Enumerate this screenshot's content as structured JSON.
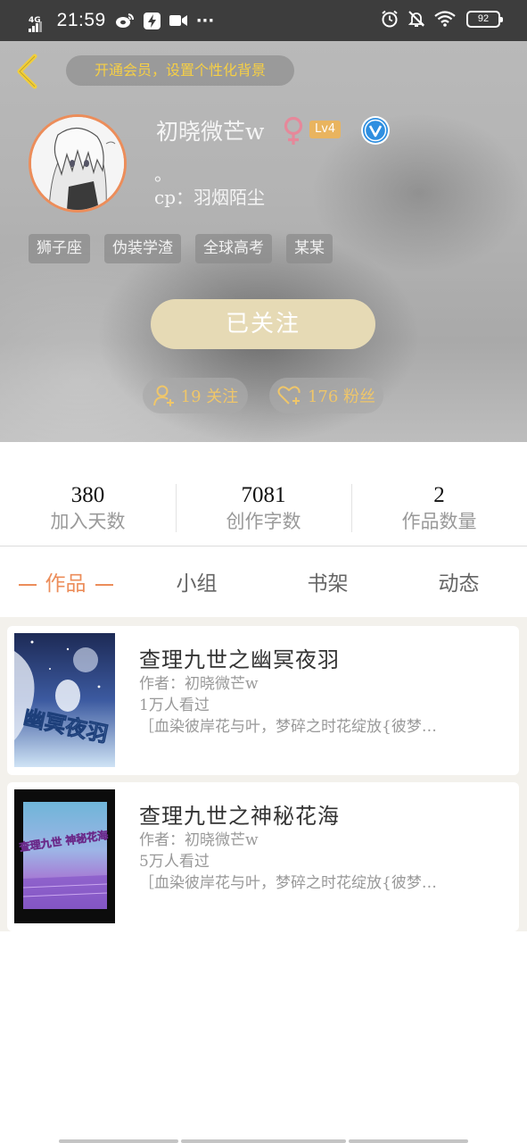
{
  "status_bar": {
    "network": "4G",
    "time": "21:59",
    "more": "···",
    "battery": "92"
  },
  "header": {
    "vip_prompt": "开通会员，设置个性化背景",
    "nickname": "初晓微芒w",
    "level": "Lv4",
    "signature_line1": "。",
    "signature_line2": "cp：羽烟陌尘",
    "tags": [
      "狮子座",
      "伪装学渣",
      "全球高考",
      "某某"
    ],
    "follow_button": "已关注",
    "follows": "19 关注",
    "fans": "176 粉丝"
  },
  "stats": [
    {
      "value": "380",
      "label": "加入天数"
    },
    {
      "value": "7081",
      "label": "创作字数"
    },
    {
      "value": "2",
      "label": "作品数量"
    }
  ],
  "tabs": [
    "作品",
    "小组",
    "书架",
    "动态"
  ],
  "works": [
    {
      "title": "查理九世之幽冥夜羽",
      "author": "作者：初晓微芒w",
      "views": "1万人看过",
      "description": "［血染彼岸花与叶，梦碎之时花绽放{彼梦…",
      "cover_text": "幽冥夜羽"
    },
    {
      "title": "查理九世之神秘花海",
      "author": "作者：初晓微芒w",
      "views": "5万人看过",
      "description": "［血染彼岸花与叶，梦碎之时花绽放{彼梦…",
      "cover_text": "查理九世 神秘花海"
    }
  ],
  "colors": {
    "accent": "#ec8d5a",
    "gold": "#f6cf45",
    "follow_button": "#e6dab5",
    "gender_female": "#e6889a"
  }
}
